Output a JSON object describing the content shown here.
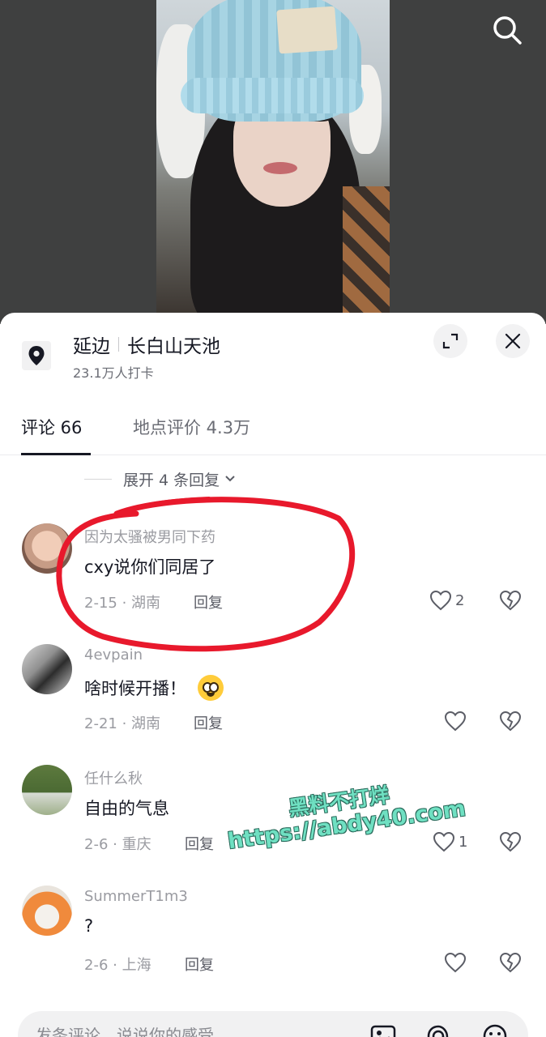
{
  "location": {
    "city": "延边",
    "place": "长白山天池",
    "checkins": "23.1万人打卡"
  },
  "tabs": [
    {
      "label": "评论 66"
    },
    {
      "label": "地点评价 4.3万"
    }
  ],
  "expand_replies": "展开 4 条回复",
  "comments": [
    {
      "user": "因为太骚被男同下药",
      "text": "cxy说你们同居了",
      "meta": "2-15 · 湖南",
      "reply": "回复",
      "likes": "2"
    },
    {
      "user": "4evpain",
      "text": "啥时候开播！",
      "meta": "2-21 · 湖南",
      "reply": "回复",
      "likes": ""
    },
    {
      "user": "任什么秋",
      "text": "自由的气息",
      "meta": "2-6 · 重庆",
      "reply": "回复",
      "likes": "1"
    },
    {
      "user": "SummerT1m3",
      "text": "?",
      "meta": "2-6 · 上海",
      "reply": "回复",
      "likes": ""
    }
  ],
  "watermark": {
    "line1": "黑料不打烊",
    "line2": "https://abdy40.com"
  },
  "input": {
    "placeholder": "发条评论，说说你的感受"
  },
  "colors": {
    "annotation_red": "#e8192c",
    "watermark_green": "#6fe0c2"
  }
}
